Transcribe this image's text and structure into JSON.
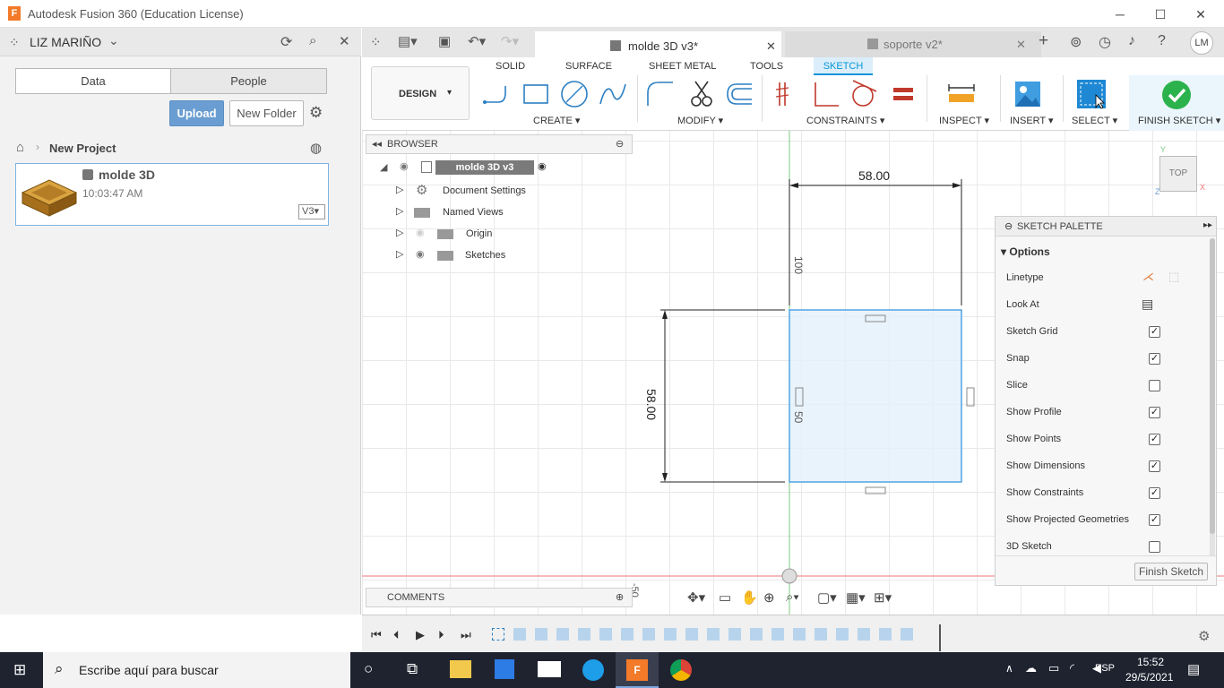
{
  "window": {
    "title": "Autodesk Fusion 360 (Education License)",
    "logo": "F"
  },
  "data_panel": {
    "user": "LIZ MARIÑO",
    "tabs": [
      "Data",
      "People"
    ],
    "upload_label": "Upload",
    "new_folder_label": "New Folder",
    "project": "New Project",
    "file": {
      "name": "molde 3D",
      "time": "10:03:47 AM",
      "version": "V3"
    }
  },
  "doc_tabs": [
    {
      "label": "molde 3D v3*",
      "active": true
    },
    {
      "label": "soporte v2*",
      "active": false
    }
  ],
  "avatar": "LM",
  "ribbon": {
    "tabs": [
      "SOLID",
      "SURFACE",
      "SHEET METAL",
      "TOOLS",
      "SKETCH"
    ],
    "design_label": "DESIGN",
    "groups": [
      "CREATE",
      "MODIFY",
      "CONSTRAINTS",
      "INSPECT",
      "INSERT",
      "SELECT",
      "FINISH SKETCH"
    ]
  },
  "browser": {
    "title": "BROWSER",
    "root": "molde 3D v3",
    "items": [
      "Document Settings",
      "Named Views",
      "Origin",
      "Sketches"
    ]
  },
  "comments": "COMMENTS",
  "viewcube": {
    "face": "TOP",
    "y": "Y",
    "x": "X",
    "z": "Z"
  },
  "sketch": {
    "dim_width": "58.00",
    "dim_height": "58.00",
    "dim_100": "100",
    "dim_50": "50",
    "dim_neg50": "-50"
  },
  "palette": {
    "title": "SKETCH PALETTE",
    "section": "Options",
    "rows": [
      {
        "label": "Linetype",
        "type": "icon"
      },
      {
        "label": "Look At",
        "type": "icon"
      },
      {
        "label": "Sketch Grid",
        "type": "check",
        "checked": true
      },
      {
        "label": "Snap",
        "type": "check",
        "checked": true
      },
      {
        "label": "Slice",
        "type": "check",
        "checked": false
      },
      {
        "label": "Show Profile",
        "type": "check",
        "checked": true
      },
      {
        "label": "Show Points",
        "type": "check",
        "checked": true
      },
      {
        "label": "Show Dimensions",
        "type": "check",
        "checked": true
      },
      {
        "label": "Show Constraints",
        "type": "check",
        "checked": true
      },
      {
        "label": "Show Projected Geometries",
        "type": "check",
        "checked": true
      },
      {
        "label": "3D Sketch",
        "type": "check",
        "checked": false
      }
    ],
    "finish_label": "Finish Sketch"
  },
  "taskbar": {
    "search_placeholder": "Escribe aquí para buscar",
    "lang": "ESP",
    "time": "15:52",
    "date": "29/5/2021"
  },
  "colors": {
    "accent": "#0696d7",
    "upload": "#6a9ed2",
    "finish": "#2bb24c",
    "taskbar": "#1f2330"
  }
}
